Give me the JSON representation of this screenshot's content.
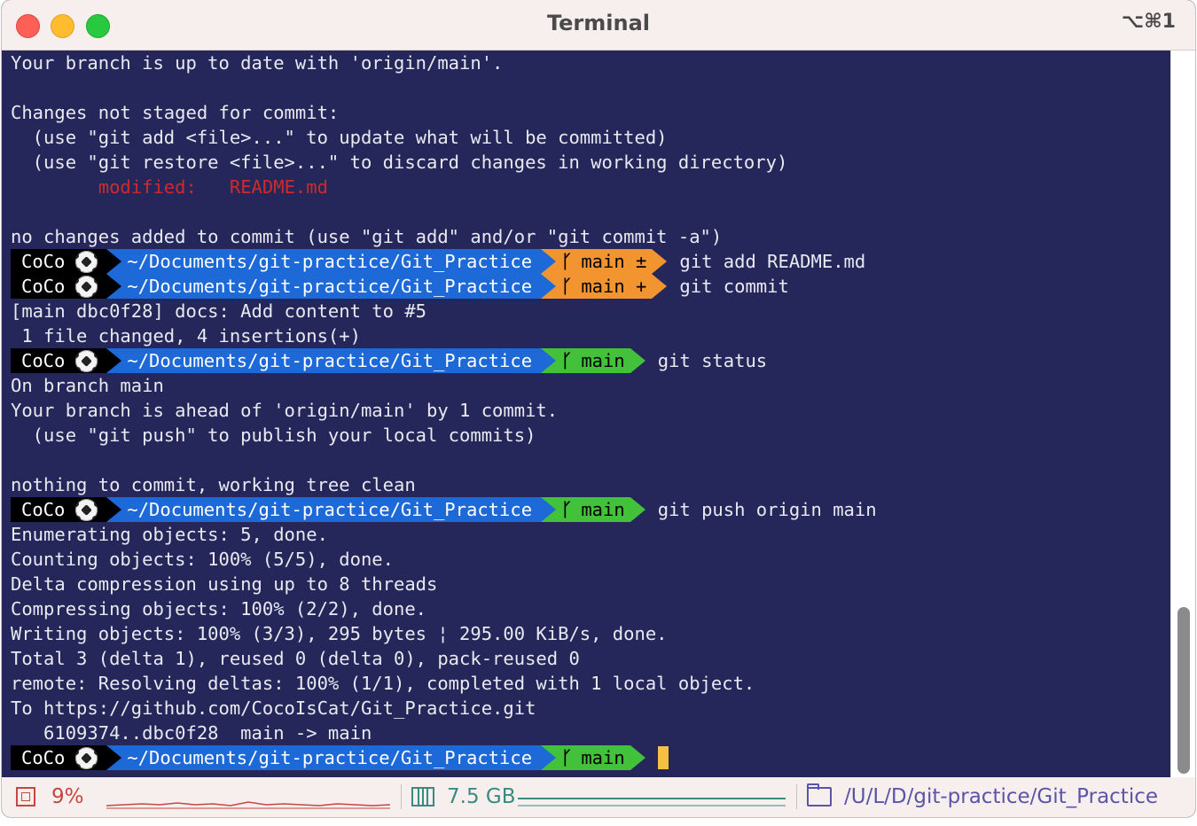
{
  "window": {
    "title": "Terminal",
    "shortcut": "⌥⌘1"
  },
  "prompt": {
    "user": "CoCo",
    "path": "~/Documents/git-practice/Git_Practice",
    "branch_icon": "ᚴ"
  },
  "lines": {
    "l0": "Your branch is up to date with 'origin/main'.",
    "l2": "Changes not staged for commit:",
    "l3": "  (use \"git add <file>...\" to update what will be committed)",
    "l4": "  (use \"git restore <file>...\" to discard changes in working directory)",
    "l5_indent": "        ",
    "l5_label": "modified:   ",
    "l5_file": "README.md",
    "l7": "no changes added to commit (use \"git add\" and/or \"git commit -a\")",
    "l10": "[main dbc0f28] docs: Add content to #5",
    "l11": " 1 file changed, 4 insertions(+)",
    "l13": "On branch main",
    "l14": "Your branch is ahead of 'origin/main' by 1 commit.",
    "l15": "  (use \"git push\" to publish your local commits)",
    "l17": "nothing to commit, working tree clean",
    "l19": "Enumerating objects: 5, done.",
    "l20": "Counting objects: 100% (5/5), done.",
    "l21": "Delta compression using up to 8 threads",
    "l22": "Compressing objects: 100% (2/2), done.",
    "l23": "Writing objects: 100% (3/3), 295 bytes ¦ 295.00 KiB/s, done.",
    "l24": "Total 3 (delta 1), reused 0 (delta 0), pack-reused 0",
    "l25": "remote: Resolving deltas: 100% (1/1), completed with 1 local object.",
    "l26": "To https://github.com/CocoIsCat/Git_Practice.git",
    "l27": "   6109374..dbc0f28  main -> main"
  },
  "prompts": {
    "p1": {
      "branch": "main ±",
      "command": "git add README.md"
    },
    "p2": {
      "branch": "main +",
      "command": "git commit"
    },
    "p3": {
      "branch": "main",
      "command": "git status"
    },
    "p4": {
      "branch": "main",
      "command": "git push origin main"
    },
    "p5": {
      "branch": "main",
      "command": ""
    }
  },
  "status": {
    "cpu": "9%",
    "memory": "7.5 GB",
    "cwd": "/U/L/D/git-practice/Git_Practice"
  },
  "colors": {
    "background": "#25275a",
    "path_segment": "#1e69d8",
    "dirty_branch": "#f29531",
    "clean_branch": "#43c13a",
    "modified_text": "#cf2a2a",
    "cursor": "#f6c142"
  }
}
